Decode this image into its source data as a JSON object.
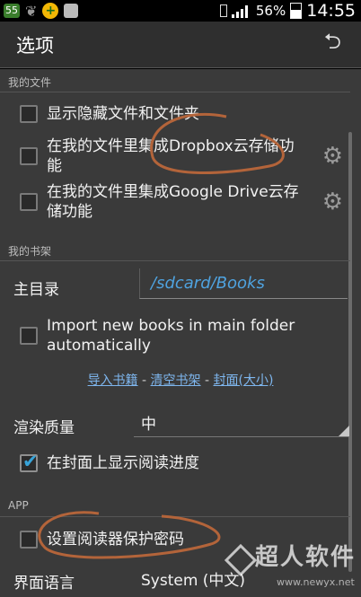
{
  "status_bar": {
    "app_badge": "55",
    "battery": "56%",
    "time": "14:55",
    "icons": [
      "app-55-icon",
      "leaf-icon",
      "plus-icon",
      "android-icon",
      "phone-icon",
      "signal-icon",
      "battery-icon"
    ]
  },
  "header": {
    "title": "选项",
    "back_icon": "return-arrow-icon"
  },
  "sections": {
    "my_files": {
      "title": "我的文件",
      "show_hidden": {
        "label": "显示隐藏文件和文件夹",
        "checked": false
      },
      "dropbox": {
        "label": "在我的文件里集成Dropbox云存储功能",
        "checked": false
      },
      "google_drive": {
        "label": "在我的文件里集成Google Drive云存储功能",
        "checked": false
      }
    },
    "my_shelf": {
      "title": "我的书架",
      "home_dir_label": "主目录",
      "home_dir_value": "/sdcard/Books",
      "import_new": {
        "label": "Import new books in main folder automatically",
        "checked": false
      },
      "links": [
        "导入书籍",
        "清空书架",
        "封面(大小)"
      ],
      "link_separator": "-",
      "render_quality_label": "渲染质量",
      "render_quality_value": "中",
      "show_progress": {
        "label": "在封面上显示阅读进度",
        "checked": true
      }
    },
    "app": {
      "title": "APP",
      "set_password": {
        "label": "设置阅读器保护密码",
        "checked": false
      },
      "language_label": "界面语言",
      "language_value": "System (中文)"
    }
  },
  "watermark": {
    "title": "超人软件",
    "url": "www.newyx.net"
  },
  "colors": {
    "accent": "#37a3d8",
    "path": "#4fa3e0",
    "link": "#7eb6ee",
    "annotation": "#b3643a"
  }
}
